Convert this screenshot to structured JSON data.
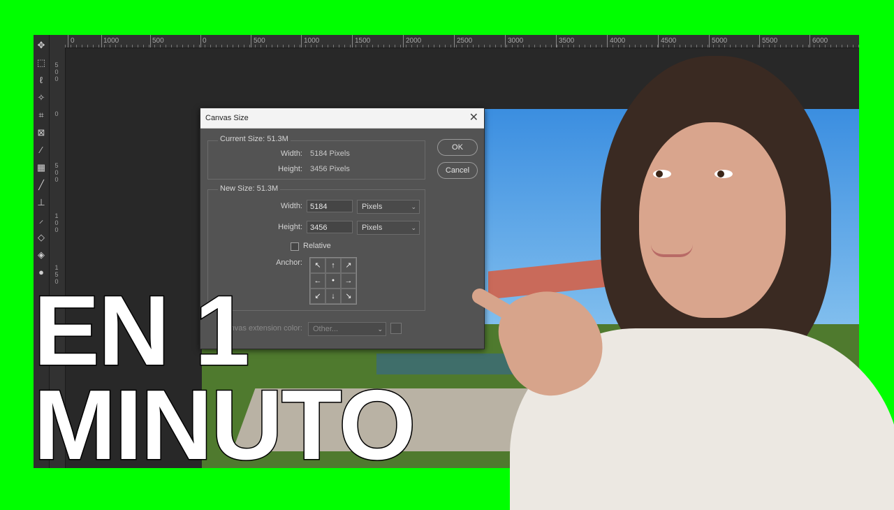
{
  "ruler": {
    "top_labels": [
      "0",
      "1000",
      "500",
      "0",
      "500",
      "1000",
      "1500",
      "2000",
      "2500",
      "3000",
      "3500",
      "4000",
      "4500",
      "5000",
      "5500",
      "6000"
    ],
    "left_labels": [
      "500",
      "0",
      "500",
      "100",
      "150"
    ]
  },
  "tools": [
    "move-icon",
    "marquee-icon",
    "lasso-icon",
    "magic-wand-icon",
    "crop-icon",
    "frame-icon",
    "eyedropper-icon",
    "healing-brush-icon",
    "brush-icon",
    "clone-stamp-icon",
    "history-brush-icon",
    "eraser-icon",
    "paint-bucket-icon",
    "blur-icon"
  ],
  "dialog": {
    "title": "Canvas Size",
    "close": "✕",
    "current_size": {
      "title": "Current Size: 51.3M",
      "width_label": "Width:",
      "width_value": "5184 Pixels",
      "height_label": "Height:",
      "height_value": "3456 Pixels"
    },
    "new_size": {
      "title": "New Size: 51.3M",
      "width_label": "Width:",
      "width_value": "5184",
      "width_unit": "Pixels",
      "height_label": "Height:",
      "height_value": "3456",
      "height_unit": "Pixels",
      "relative_label": "Relative",
      "relative_checked": false,
      "anchor_label": "Anchor:",
      "anchor_cells": [
        "↖",
        "↑",
        "↗",
        "←",
        "●",
        "→",
        "↙",
        "↓",
        "↘"
      ]
    },
    "extension_color_label": "Canvas extension color:",
    "extension_color_value": "Other...",
    "ok_label": "OK",
    "cancel_label": "Cancel"
  },
  "overlay": {
    "line1": "EN 1",
    "line2": "MINUTO"
  },
  "colors": {
    "background": "#00ff00",
    "overlay_text": "#ffffff"
  }
}
